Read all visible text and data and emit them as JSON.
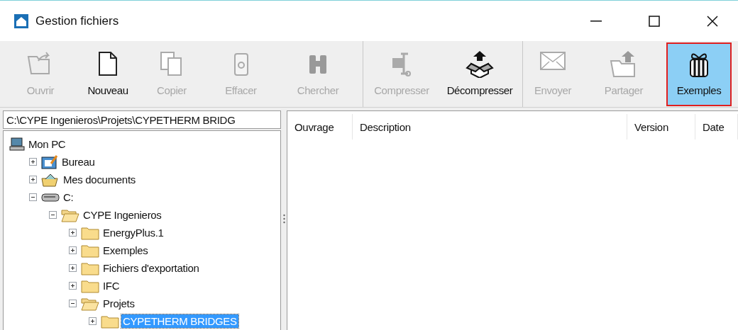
{
  "window": {
    "title": "Gestion fichiers"
  },
  "toolbar": {
    "groups": [
      [
        {
          "label": "Ouvrir",
          "disabled": true,
          "highlighted": false
        },
        {
          "label": "Nouveau",
          "disabled": false,
          "highlighted": false
        },
        {
          "label": "Copier",
          "disabled": true,
          "highlighted": false
        },
        {
          "label": "Effacer",
          "disabled": true,
          "highlighted": false
        },
        {
          "label": "Chercher",
          "disabled": true,
          "highlighted": false
        }
      ],
      [
        {
          "label": "Compresser",
          "disabled": true,
          "highlighted": false
        },
        {
          "label": "Décompresser",
          "disabled": false,
          "highlighted": false
        }
      ],
      [
        {
          "label": "Envoyer",
          "disabled": true,
          "highlighted": false
        },
        {
          "label": "Partager",
          "disabled": true,
          "highlighted": false
        },
        {
          "label": "Exemples",
          "disabled": false,
          "highlighted": true
        }
      ]
    ]
  },
  "path": {
    "value": "C:\\CYPE Ingenieros\\Projets\\CYPETHERM BRIDG"
  },
  "tree": [
    {
      "label": "Mon PC",
      "kind": "computer",
      "selected": false,
      "children": [
        {
          "label": "Bureau",
          "kind": "desktop",
          "expanded": false,
          "selected": false
        },
        {
          "label": "Mes documents",
          "kind": "documents",
          "expanded": false,
          "selected": false
        },
        {
          "label": "C:",
          "kind": "drive",
          "expanded": true,
          "selected": false,
          "children": [
            {
              "label": "CYPE Ingenieros",
              "kind": "folder",
              "expanded": true,
              "selected": false,
              "children": [
                {
                  "label": "EnergyPlus.1",
                  "kind": "folder",
                  "expanded": false,
                  "selected": false
                },
                {
                  "label": "Exemples",
                  "kind": "folder",
                  "expanded": false,
                  "selected": false
                },
                {
                  "label": "Fichiers d'exportation",
                  "kind": "folder",
                  "expanded": false,
                  "selected": false
                },
                {
                  "label": "IFC",
                  "kind": "folder",
                  "expanded": false,
                  "selected": false
                },
                {
                  "label": "Projets",
                  "kind": "folder",
                  "expanded": true,
                  "selected": false,
                  "children": [
                    {
                      "label": "CYPETHERM BRIDGES",
                      "kind": "folder",
                      "expanded": false,
                      "selected": true
                    }
                  ]
                }
              ]
            }
          ]
        }
      ]
    }
  ],
  "table": {
    "columns": [
      "Ouvrage",
      "Description",
      "Version",
      "Date"
    ]
  }
}
